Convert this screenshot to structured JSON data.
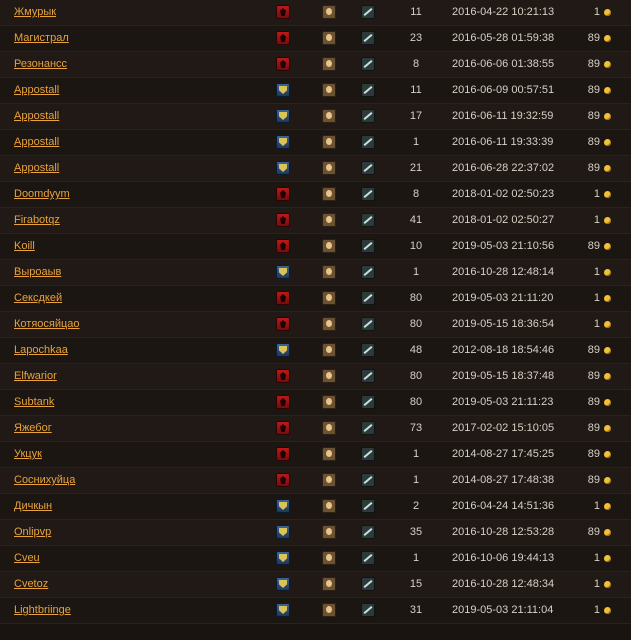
{
  "colors": {
    "accent": "#e8a33a",
    "horde": "#c41a1a",
    "alliance": "#3c6a9a",
    "coin": "#f2c232"
  },
  "rows": [
    {
      "name": "Жмурык",
      "faction": "horde",
      "level": "11",
      "date": "2016-04-22 10:21:13",
      "cost": "1"
    },
    {
      "name": "Магистрал",
      "faction": "horde",
      "level": "23",
      "date": "2016-05-28 01:59:38",
      "cost": "89"
    },
    {
      "name": "Резонансс",
      "faction": "horde",
      "level": "8",
      "date": "2016-06-06 01:38:55",
      "cost": "89"
    },
    {
      "name": "Appostall",
      "faction": "alliance",
      "level": "11",
      "date": "2016-06-09 00:57:51",
      "cost": "89"
    },
    {
      "name": "Appostall",
      "faction": "alliance",
      "level": "17",
      "date": "2016-06-11 19:32:59",
      "cost": "89"
    },
    {
      "name": "Appostall",
      "faction": "alliance",
      "level": "1",
      "date": "2016-06-11 19:33:39",
      "cost": "89"
    },
    {
      "name": "Appostall",
      "faction": "alliance",
      "level": "21",
      "date": "2016-06-28 22:37:02",
      "cost": "89"
    },
    {
      "name": "Doomdyym",
      "faction": "horde",
      "level": "8",
      "date": "2018-01-02 02:50:23",
      "cost": "1"
    },
    {
      "name": "Firabotqz",
      "faction": "horde",
      "level": "41",
      "date": "2018-01-02 02:50:27",
      "cost": "1"
    },
    {
      "name": "Koill",
      "faction": "horde",
      "level": "10",
      "date": "2019-05-03 21:10:56",
      "cost": "89"
    },
    {
      "name": "Выроаыв",
      "faction": "alliance",
      "level": "1",
      "date": "2016-10-28 12:48:14",
      "cost": "1"
    },
    {
      "name": "Сексдкей",
      "faction": "horde",
      "level": "80",
      "date": "2019-05-03 21:11:20",
      "cost": "1"
    },
    {
      "name": "Котяосяйцао",
      "faction": "horde",
      "level": "80",
      "date": "2019-05-15 18:36:54",
      "cost": "1"
    },
    {
      "name": "Lapochkaa",
      "faction": "alliance",
      "level": "48",
      "date": "2012-08-18 18:54:46",
      "cost": "89"
    },
    {
      "name": "Elfwarior",
      "faction": "horde",
      "level": "80",
      "date": "2019-05-15 18:37:48",
      "cost": "89"
    },
    {
      "name": "Subtank",
      "faction": "horde",
      "level": "80",
      "date": "2019-05-03 21:11:23",
      "cost": "89"
    },
    {
      "name": "Яжебог",
      "faction": "horde",
      "level": "73",
      "date": "2017-02-02 15:10:05",
      "cost": "89"
    },
    {
      "name": "Укцук",
      "faction": "horde",
      "level": "1",
      "date": "2014-08-27 17:45:25",
      "cost": "89"
    },
    {
      "name": "Соснихуйца",
      "faction": "horde",
      "level": "1",
      "date": "2014-08-27 17:48:38",
      "cost": "89"
    },
    {
      "name": "Дичкын",
      "faction": "alliance",
      "level": "2",
      "date": "2016-04-24 14:51:36",
      "cost": "1"
    },
    {
      "name": "Onlipvp",
      "faction": "alliance",
      "level": "35",
      "date": "2016-10-28 12:53:28",
      "cost": "89"
    },
    {
      "name": "Cveu",
      "faction": "alliance",
      "level": "1",
      "date": "2016-10-06 19:44:13",
      "cost": "1"
    },
    {
      "name": "Cvetoz",
      "faction": "alliance",
      "level": "15",
      "date": "2016-10-28 12:48:34",
      "cost": "1"
    },
    {
      "name": "Lightbriinge",
      "faction": "alliance",
      "level": "31",
      "date": "2019-05-03 21:11:04",
      "cost": "1"
    }
  ]
}
